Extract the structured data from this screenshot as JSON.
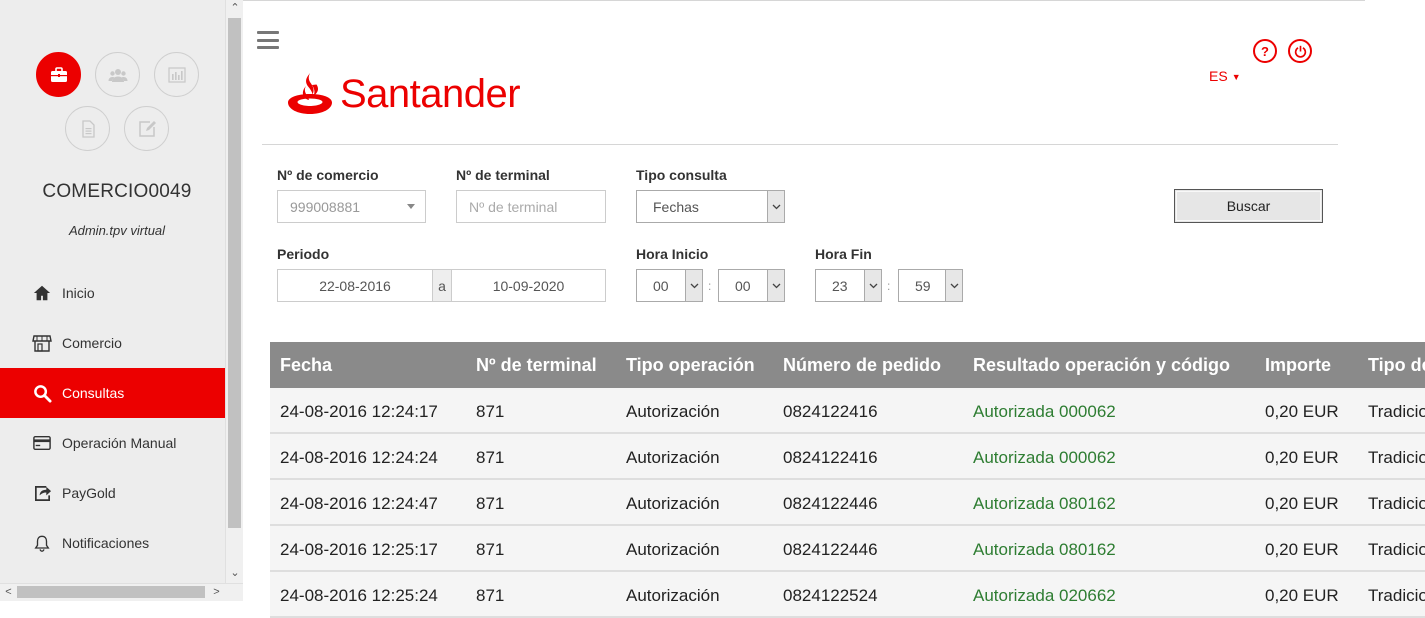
{
  "sidebar": {
    "user_name": "COMERCIO0049",
    "user_role": "Admin.tpv virtual",
    "icons": [
      "briefcase-icon",
      "users-icon",
      "bar-chart-icon",
      "document-icon",
      "edit-icon"
    ],
    "items": [
      {
        "label": "Inicio",
        "icon": "home-icon"
      },
      {
        "label": "Comercio",
        "icon": "store-icon"
      },
      {
        "label": "Consultas",
        "icon": "search-icon"
      },
      {
        "label": "Operación Manual",
        "icon": "credit-card-icon"
      },
      {
        "label": "PayGold",
        "icon": "share-icon"
      },
      {
        "label": "Notificaciones",
        "icon": "bell-icon"
      }
    ],
    "active_item": "Consultas"
  },
  "header": {
    "logo_text": "Santander",
    "language": "ES",
    "help_icon": "?",
    "power_icon": "power-icon"
  },
  "filters": {
    "comercio_label": "Nº de comercio",
    "comercio_value": "999008881",
    "terminal_label": "Nº de terminal",
    "terminal_placeholder": "Nº de terminal",
    "tipo_label": "Tipo consulta",
    "tipo_value": "Fechas",
    "periodo_label": "Periodo",
    "fecha_inicio": "22-08-2016",
    "periodo_sep": "a",
    "fecha_fin": "10-09-2020",
    "hora_inicio_label": "Hora Inicio",
    "hora_inicio_h": "00",
    "hora_inicio_m": "00",
    "hora_fin_label": "Hora Fin",
    "hora_fin_h": "23",
    "hora_fin_m": "59",
    "time_sep": ":",
    "buscar_label": "Buscar"
  },
  "table": {
    "headers": [
      "Fecha",
      "Nº de terminal",
      "Tipo operación",
      "Número de pedido",
      "Resultado operación y código",
      "Importe",
      "Tipo de"
    ],
    "rows": [
      [
        "24-08-2016 12:24:17",
        "871",
        "Autorización",
        "0824122416",
        "Autorizada 000062",
        "0,20 EUR",
        "Tradicio"
      ],
      [
        "24-08-2016 12:24:24",
        "871",
        "Autorización",
        "0824122416",
        "Autorizada 000062",
        "0,20 EUR",
        "Tradicio"
      ],
      [
        "24-08-2016 12:24:47",
        "871",
        "Autorización",
        "0824122446",
        "Autorizada 080162",
        "0,20 EUR",
        "Tradicio"
      ],
      [
        "24-08-2016 12:25:17",
        "871",
        "Autorización",
        "0824122446",
        "Autorizada 080162",
        "0,20 EUR",
        "Tradicio"
      ],
      [
        "24-08-2016 12:25:24",
        "871",
        "Autorización",
        "0824122524",
        "Autorizada 020662",
        "0,20 EUR",
        "Tradicio"
      ]
    ]
  },
  "colors": {
    "brand": "#ec0000",
    "success": "#2e7d32",
    "table_header": "#8a8a8a"
  }
}
